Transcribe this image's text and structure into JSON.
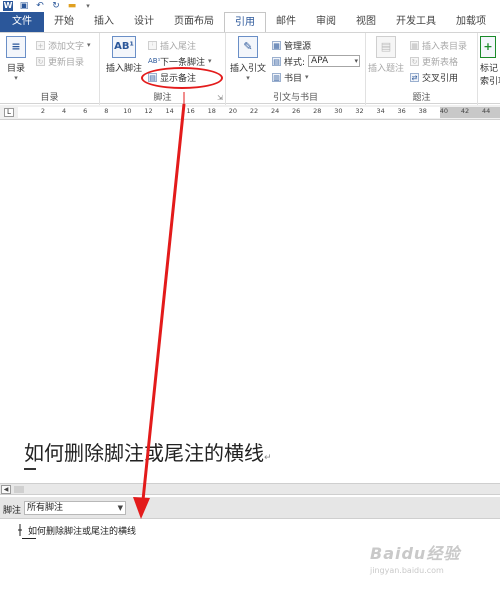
{
  "quick_access": {
    "icons": [
      "word-logo-icon",
      "save-icon",
      "undo-icon",
      "redo-icon",
      "open-folder-icon"
    ]
  },
  "tabs": [
    {
      "label": "文件",
      "active": false
    },
    {
      "label": "开始",
      "active": false
    },
    {
      "label": "插入",
      "active": false
    },
    {
      "label": "设计",
      "active": false
    },
    {
      "label": "页面布局",
      "active": false
    },
    {
      "label": "引用",
      "active": true
    },
    {
      "label": "邮件",
      "active": false
    },
    {
      "label": "审阅",
      "active": false
    },
    {
      "label": "视图",
      "active": false
    },
    {
      "label": "开发工具",
      "active": false
    },
    {
      "label": "加载项",
      "active": false
    }
  ],
  "ribbon": {
    "toc_group": {
      "label": "目录",
      "toc_button": "目录",
      "add_text": "添加文字",
      "update_toc": "更新目录"
    },
    "footnotes_group": {
      "label": "脚注",
      "insert_footnote": "插入脚注",
      "insert_endnote": "插入尾注",
      "next_footnote": "下一条脚注",
      "show_notes": "显示备注"
    },
    "citations_group": {
      "label": "引文与书目",
      "insert_citation": "插入引文",
      "manage_sources": "管理源",
      "style_label": "样式:",
      "style_value": "APA",
      "bibliography": "书目"
    },
    "captions_group": {
      "label": "题注",
      "insert_caption": "插入题注",
      "insert_table_of_figures": "插入表目录",
      "update_table": "更新表格",
      "cross_reference": "交叉引用"
    },
    "index_group": {
      "mark_entry": "标记\n索引项"
    }
  },
  "ruler": {
    "ticks": [
      "2",
      "4",
      "6",
      "8",
      "10",
      "12",
      "14",
      "16",
      "18",
      "20",
      "22",
      "24",
      "26",
      "28",
      "30",
      "32",
      "34",
      "36",
      "38",
      "40",
      "42",
      "44"
    ]
  },
  "document": {
    "heading": "如何删除脚注或尾注的横线"
  },
  "notes_pane": {
    "label": "脚注",
    "filter_value": "所有脚注",
    "footnote_text": "如何删除脚注或尾注的横线"
  },
  "watermark": {
    "logo": "Baidu经验",
    "sub": "jingyan.baidu.com"
  },
  "colors": {
    "accent": "#2b579a",
    "highlight": "#e31b1b"
  }
}
